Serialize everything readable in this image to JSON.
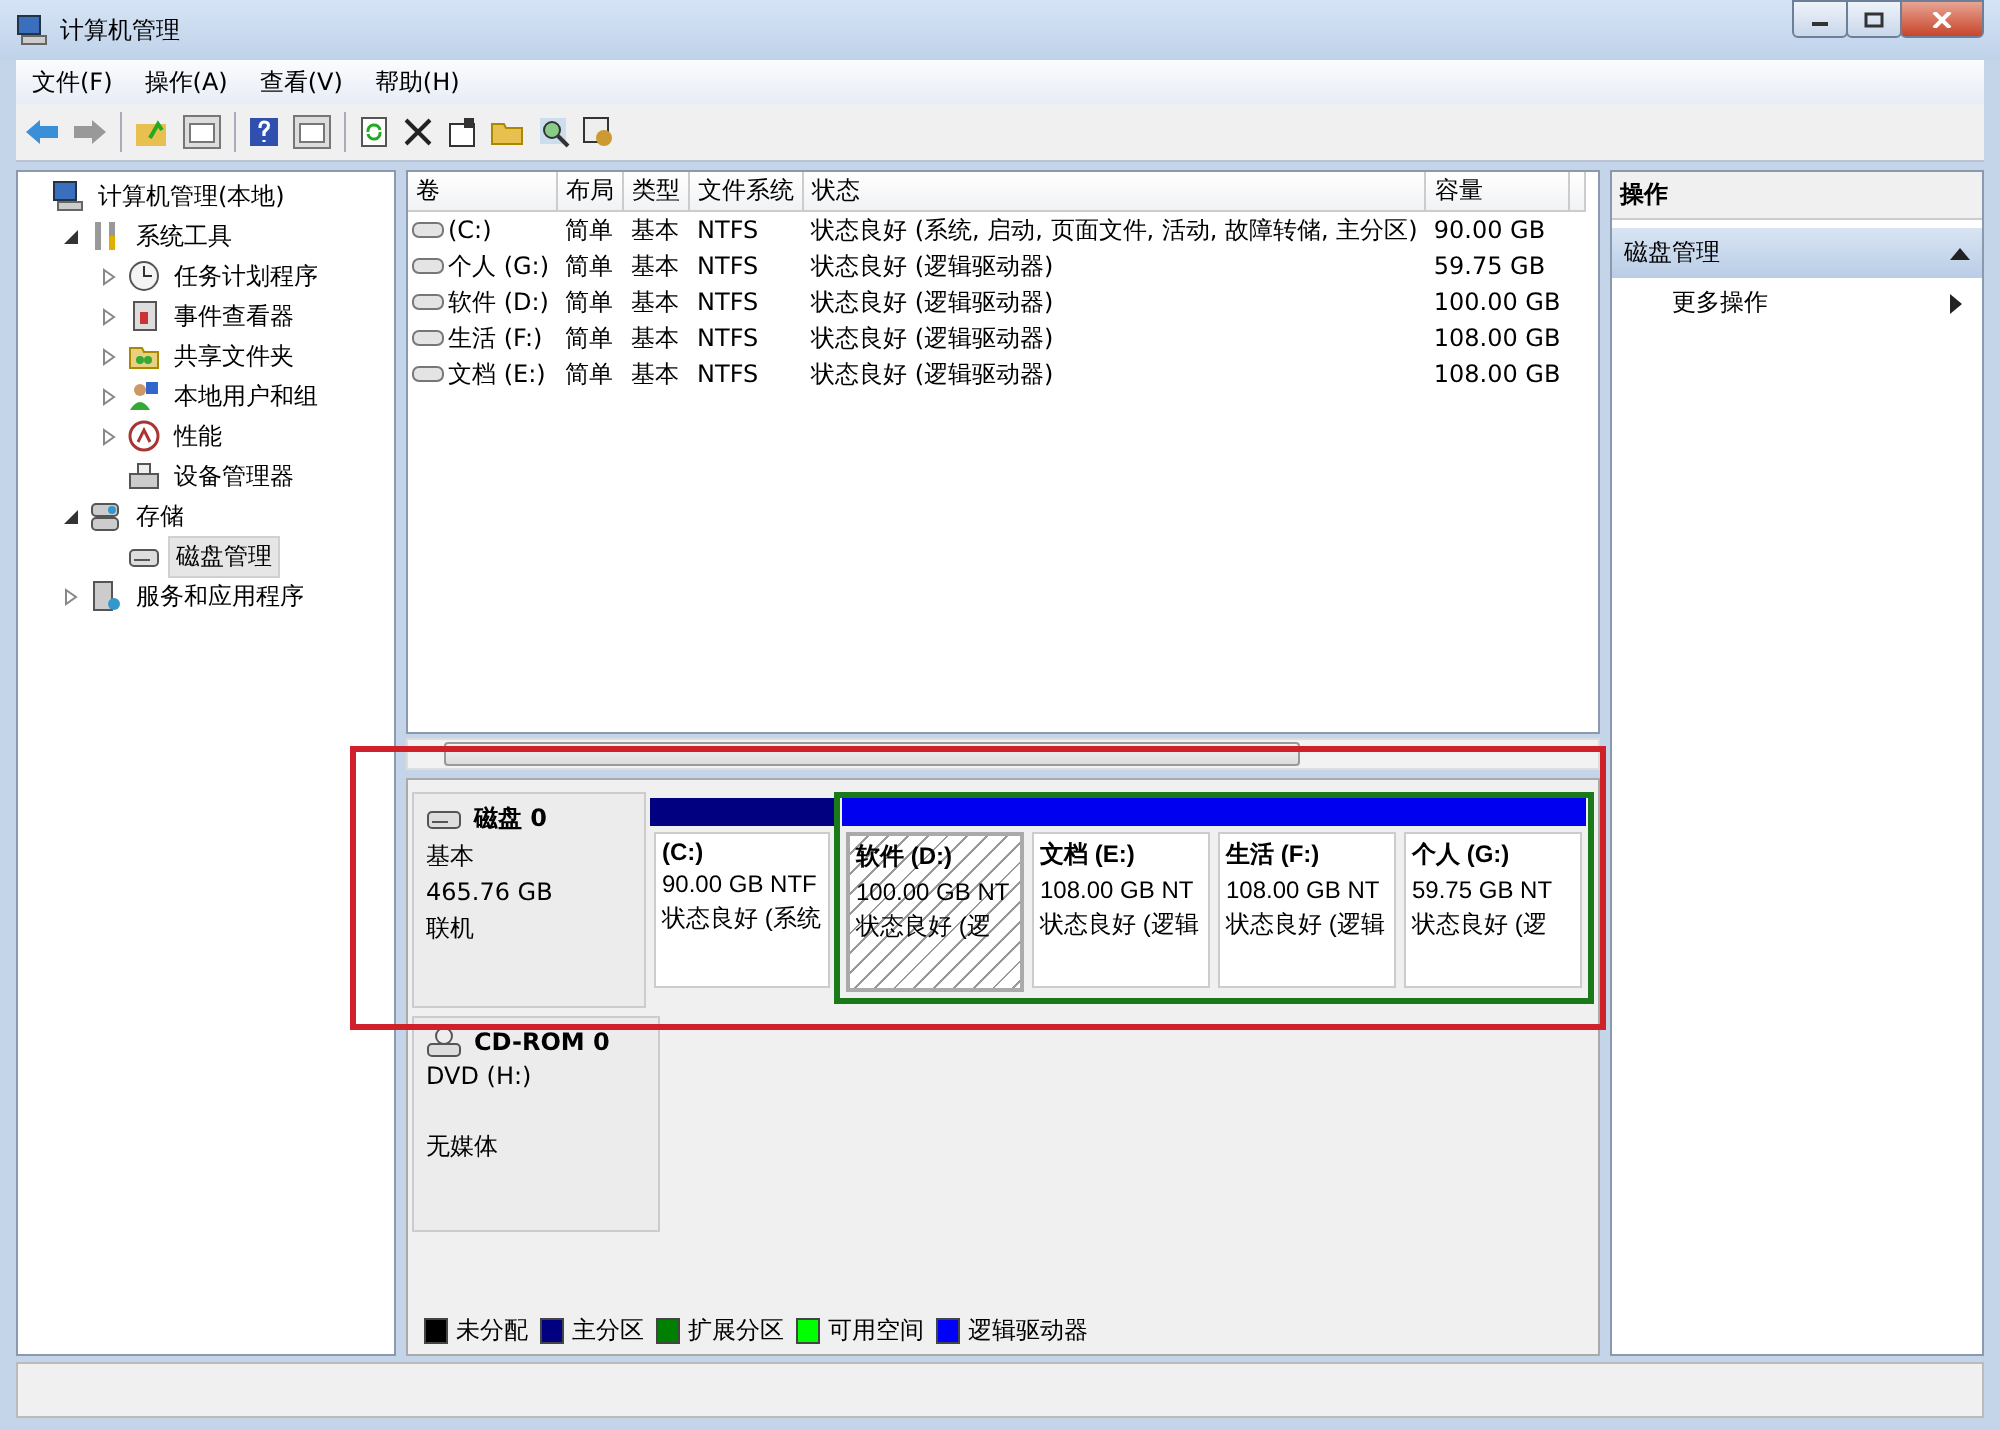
{
  "window": {
    "title": "计算机管理"
  },
  "menu": [
    "文件(F)",
    "操作(A)",
    "查看(V)",
    "帮助(H)"
  ],
  "tree": [
    {
      "label": "计算机管理(本地)",
      "selected": false,
      "children": [
        {
          "label": "系统工具",
          "expanded": true,
          "selected": false,
          "children": [
            {
              "label": "任务计划程序",
              "expanded": false,
              "selected": false
            },
            {
              "label": "事件查看器",
              "expanded": false,
              "selected": false
            },
            {
              "label": "共享文件夹",
              "expanded": false,
              "selected": false
            },
            {
              "label": "本地用户和组",
              "expanded": false,
              "selected": false
            },
            {
              "label": "性能",
              "expanded": false,
              "selected": false
            },
            {
              "label": "设备管理器",
              "selected": false
            }
          ]
        },
        {
          "label": "存储",
          "expanded": true,
          "selected": false,
          "children": [
            {
              "label": "磁盘管理",
              "selected": true
            }
          ]
        },
        {
          "label": "服务和应用程序",
          "expanded": false,
          "selected": false
        }
      ]
    }
  ],
  "table": {
    "columns": [
      "卷",
      "布局",
      "类型",
      "文件系统",
      "状态",
      "容量"
    ],
    "rows": [
      [
        "(C:)",
        "简单",
        "基本",
        "NTFS",
        "状态良好 (系统, 启动, 页面文件, 活动, 故障转储, 主分区)",
        "90.00 GB"
      ],
      [
        "个人 (G:)",
        "简单",
        "基本",
        "NTFS",
        "状态良好 (逻辑驱动器)",
        "59.75 GB"
      ],
      [
        "软件 (D:)",
        "简单",
        "基本",
        "NTFS",
        "状态良好 (逻辑驱动器)",
        "100.00 GB"
      ],
      [
        "生活 (F:)",
        "简单",
        "基本",
        "NTFS",
        "状态良好 (逻辑驱动器)",
        "108.00 GB"
      ],
      [
        "文档 (E:)",
        "简单",
        "基本",
        "NTFS",
        "状态良好 (逻辑驱动器)",
        "108.00 GB"
      ]
    ]
  },
  "disks": [
    {
      "name": "磁盘 0",
      "kind": "disk",
      "lines": [
        "基本",
        "465.76 GB",
        "联机"
      ],
      "partitions": [
        {
          "name": "(C:)",
          "size": "90.00 GB NTF",
          "status": "状态良好 (系统",
          "kind": "primary",
          "selected": false
        }
      ],
      "extended_partitions": [
        {
          "name": "软件 (D:)",
          "size": "100.00 GB NT",
          "status": "状态良好 (逻",
          "kind": "logical",
          "selected": true
        },
        {
          "name": "文档 (E:)",
          "size": "108.00 GB NT",
          "status": "状态良好 (逻辑",
          "kind": "logical",
          "selected": false
        },
        {
          "name": "生活 (F:)",
          "size": "108.00 GB NT",
          "status": "状态良好 (逻辑",
          "kind": "logical",
          "selected": false
        },
        {
          "name": "个人 (G:)",
          "size": "59.75 GB NT",
          "status": "状态良好 (逻",
          "kind": "logical",
          "selected": false
        }
      ]
    },
    {
      "name": "CD-ROM 0",
      "kind": "cdrom",
      "lines": [
        "DVD (H:)",
        "无媒体"
      ]
    }
  ],
  "legend": [
    {
      "label": "未分配",
      "color": "#000000"
    },
    {
      "label": "主分区",
      "color": "#000080"
    },
    {
      "label": "扩展分区",
      "color": "#008000"
    },
    {
      "label": "可用空间",
      "color": "#00ff00"
    },
    {
      "label": "逻辑驱动器",
      "color": "#0000ff"
    }
  ],
  "actions": {
    "header": "操作",
    "section": "磁盘管理",
    "items": [
      "更多操作"
    ]
  }
}
